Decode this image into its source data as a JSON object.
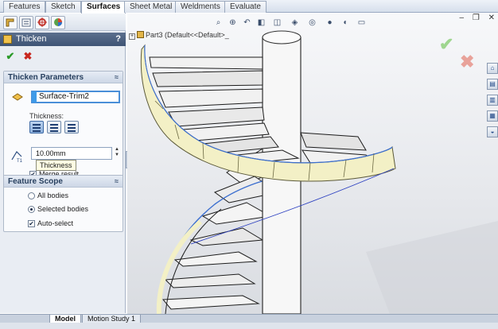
{
  "command_tabs": [
    "Features",
    "Sketch",
    "Surfaces",
    "Sheet Metal",
    "Weldments",
    "Evaluate"
  ],
  "active_tab": "Surfaces",
  "pm_tabs": [
    "feature-manager-icon",
    "property-manager-icon",
    "configuration-manager-icon",
    "display-manager-icon"
  ],
  "pm": {
    "title": "Thicken",
    "help": "?",
    "ok_symbol": "✔",
    "cancel_symbol": "✖"
  },
  "thicken_params": {
    "header": "Thicken Parameters",
    "collapse": "≈",
    "surface": "Surface-Trim2",
    "thickness_label": "Thickness:",
    "side_options": [
      "thicken-side-1",
      "thicken-both-sides",
      "thicken-side-2"
    ],
    "selected_side": 0,
    "thickness_value": "10.00mm",
    "tooltip": "Thickness",
    "merge_label": "Merge result",
    "merge_checked": true,
    "t1_label": "T1"
  },
  "feature_scope": {
    "header": "Feature Scope",
    "collapse": "≈",
    "options": [
      "All bodies",
      "Selected bodies"
    ],
    "selected": 1,
    "auto_select_label": "Auto-select",
    "auto_select_checked": true
  },
  "viewport": {
    "tree_node": "Part3  (Default<<Default>_",
    "window_controls": [
      "–",
      "❐",
      "✕"
    ]
  },
  "bottom_tabs": [
    "Model",
    "Motion Study 1"
  ],
  "active_bottom_tab": "Model",
  "colors": {
    "accent_blue": "#4a8fd8",
    "stair_yellow": "#f3f0c6",
    "confirm_green": "#2b9a28",
    "cancel_red": "#c8261e"
  }
}
